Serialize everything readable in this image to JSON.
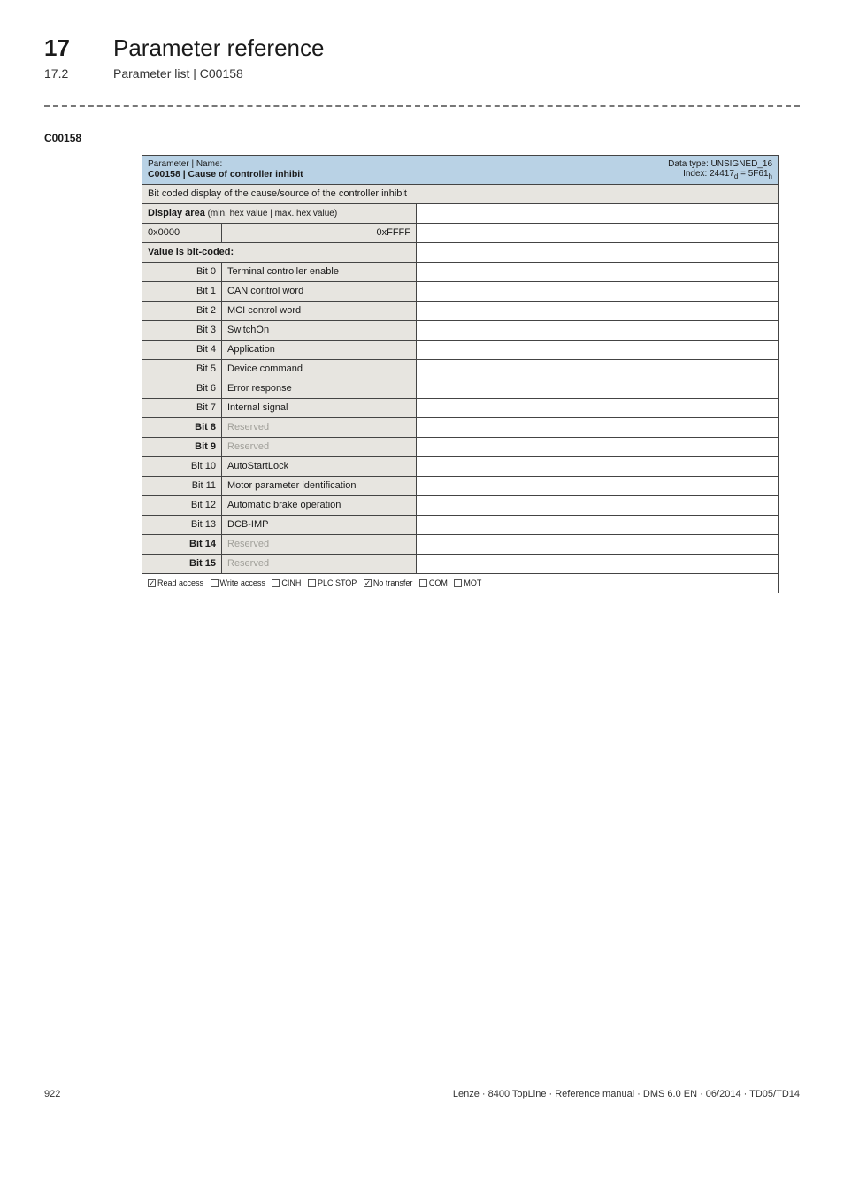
{
  "header": {
    "number": "17",
    "title": "Parameter reference",
    "sub_number": "17.2",
    "sub_title": "Parameter list | C00158"
  },
  "param_code": "C00158",
  "titlebar": {
    "param_label": "Parameter | Name:",
    "name": "C00158 | Cause of controller inhibit",
    "datatype": "Data type: UNSIGNED_16",
    "index_prefix": "Index: 24417",
    "index_d": "d",
    "index_eq": " = 5F61",
    "index_h": "h"
  },
  "description": "Bit coded display of the cause/source of the controller inhibit",
  "display_area_label": "Display area",
  "display_area_small": " (min. hex value | max. hex value)",
  "hex_min": "0x0000",
  "hex_max": "0xFFFF",
  "value_coded": "Value is bit-coded:",
  "bits": [
    {
      "label": "Bit 0",
      "value": "Terminal controller enable",
      "reserved": false
    },
    {
      "label": "Bit 1",
      "value": "CAN control word",
      "reserved": false
    },
    {
      "label": "Bit 2",
      "value": "MCI control word",
      "reserved": false
    },
    {
      "label": "Bit 3",
      "value": "SwitchOn",
      "reserved": false
    },
    {
      "label": "Bit 4",
      "value": "Application",
      "reserved": false
    },
    {
      "label": "Bit 5",
      "value": "Device command",
      "reserved": false
    },
    {
      "label": "Bit 6",
      "value": "Error response",
      "reserved": false
    },
    {
      "label": "Bit 7",
      "value": "Internal signal",
      "reserved": false
    },
    {
      "label": "Bit 8",
      "value": "Reserved",
      "reserved": true
    },
    {
      "label": "Bit 9",
      "value": "Reserved",
      "reserved": true
    },
    {
      "label": "Bit 10",
      "value": "AutoStartLock",
      "reserved": false
    },
    {
      "label": "Bit 11",
      "value": "Motor parameter identification",
      "reserved": false
    },
    {
      "label": "Bit 12",
      "value": "Automatic brake operation",
      "reserved": false
    },
    {
      "label": "Bit 13",
      "value": "DCB-IMP",
      "reserved": false
    },
    {
      "label": "Bit 14",
      "value": "Reserved",
      "reserved": true
    },
    {
      "label": "Bit 15",
      "value": "Reserved",
      "reserved": true
    }
  ],
  "access": {
    "read": {
      "checked": true,
      "label": "Read access"
    },
    "write": {
      "checked": false,
      "label": "Write access"
    },
    "cinh": {
      "checked": false,
      "label": "CINH"
    },
    "plc": {
      "checked": false,
      "label": "PLC STOP"
    },
    "notransfer": {
      "checked": true,
      "label": "No transfer"
    },
    "com": {
      "checked": false,
      "label": "COM"
    },
    "mot": {
      "checked": false,
      "label": "MOT"
    }
  },
  "footer": {
    "page": "922",
    "doc": "Lenze · 8400 TopLine · Reference manual · DMS 6.0 EN · 06/2014 · TD05/TD14"
  }
}
